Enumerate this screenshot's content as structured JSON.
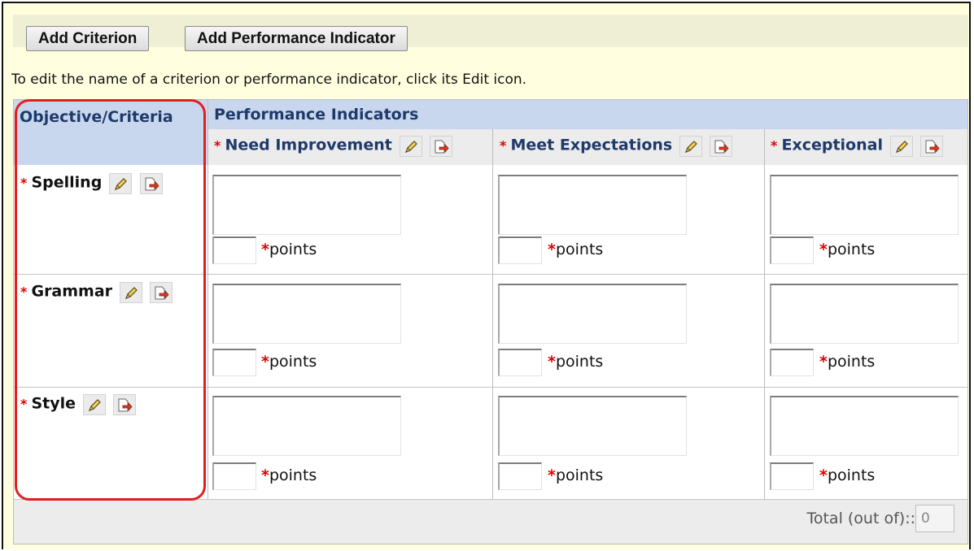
{
  "toolbar": {
    "add_criterion_label": "Add Criterion",
    "add_indicator_label": "Add Performance Indicator"
  },
  "instructions": "To edit the name of a criterion or performance indicator, click its Edit icon.",
  "rubric": {
    "criteria_header": "Objective/Criteria",
    "indicators_header": "Performance Indicators",
    "required_marker": "*",
    "levels": [
      {
        "label": "Need Improvement"
      },
      {
        "label": "Meet Expectations"
      },
      {
        "label": "Exceptional"
      }
    ],
    "criteria": [
      {
        "label": "Spelling"
      },
      {
        "label": "Grammar"
      },
      {
        "label": "Style"
      }
    ],
    "points_label": "points",
    "total_label": "Total (out of)::",
    "total_value": "0"
  },
  "icons": {
    "edit": "pencil-icon",
    "delete": "delete-page-icon"
  },
  "colors": {
    "page_background": "#ffffe0",
    "header_blue": "#c9d7ee",
    "header_text": "#1e3a6a",
    "required_red": "#dd0000",
    "highlight_red": "#e02020"
  }
}
